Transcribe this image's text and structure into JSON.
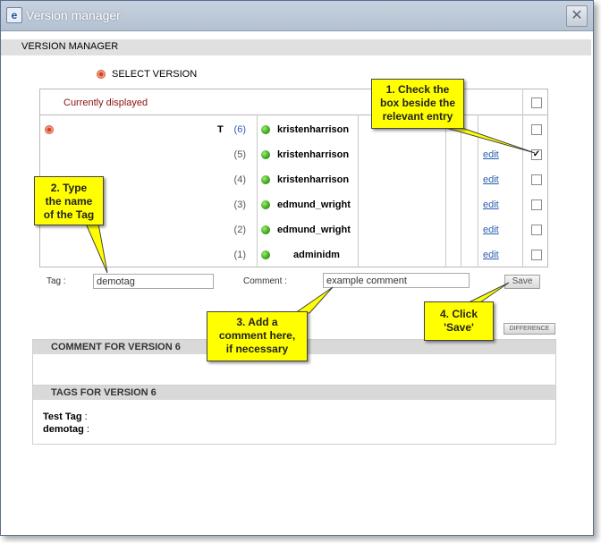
{
  "window": {
    "title": "Version manager",
    "close_glyph": "✕",
    "app_icon_glyph": "e"
  },
  "header": {
    "title": "VERSION MANAGER"
  },
  "select_version": {
    "label": "SELECT VERSION"
  },
  "table": {
    "currently_displayed": "Currently displayed",
    "current_marker": "T",
    "rows": [
      {
        "version": "(6)",
        "author": "kristenharrison",
        "edit": "",
        "checked": false,
        "link": true
      },
      {
        "version": "(5)",
        "author": "kristenharrison",
        "edit": "edit",
        "checked": true,
        "link": false
      },
      {
        "version": "(4)",
        "author": "kristenharrison",
        "edit": "edit",
        "checked": false,
        "link": false
      },
      {
        "version": "(3)",
        "author": "edmund_wright",
        "edit": "edit",
        "checked": false,
        "link": false
      },
      {
        "version": "(2)",
        "author": "edmund_wright",
        "edit": "edit",
        "checked": false,
        "link": false
      },
      {
        "version": "(1)",
        "author": "adminidm",
        "edit": "edit",
        "checked": false,
        "link": false
      }
    ]
  },
  "form": {
    "tag_label": "Tag :",
    "tag_value": "demotag",
    "comment_label": "Comment :",
    "comment_value": "example comment",
    "save_label": "Save",
    "difference_label": "DIFFERENCE"
  },
  "comment_panel": {
    "title": "COMMENT FOR VERSION 6"
  },
  "tags_panel": {
    "title": "TAGS FOR VERSION 6",
    "tags": [
      {
        "name": "Test Tag",
        "sep": ":"
      },
      {
        "name": "demotag",
        "sep": ":"
      }
    ]
  },
  "callouts": {
    "c1": [
      "1. Check the",
      "box beside the",
      "relevant entry"
    ],
    "c2": [
      "2. Type",
      "the name",
      "of the Tag"
    ],
    "c3": [
      "3. Add a",
      "comment here,",
      "if necessary"
    ],
    "c4": [
      "4. Click",
      "'Save'"
    ]
  },
  "colors": {
    "callout": "#ffff00",
    "currently_displayed": "#8b0f0f",
    "link": "#2a5db0",
    "status_dot": "#2e9a12"
  }
}
